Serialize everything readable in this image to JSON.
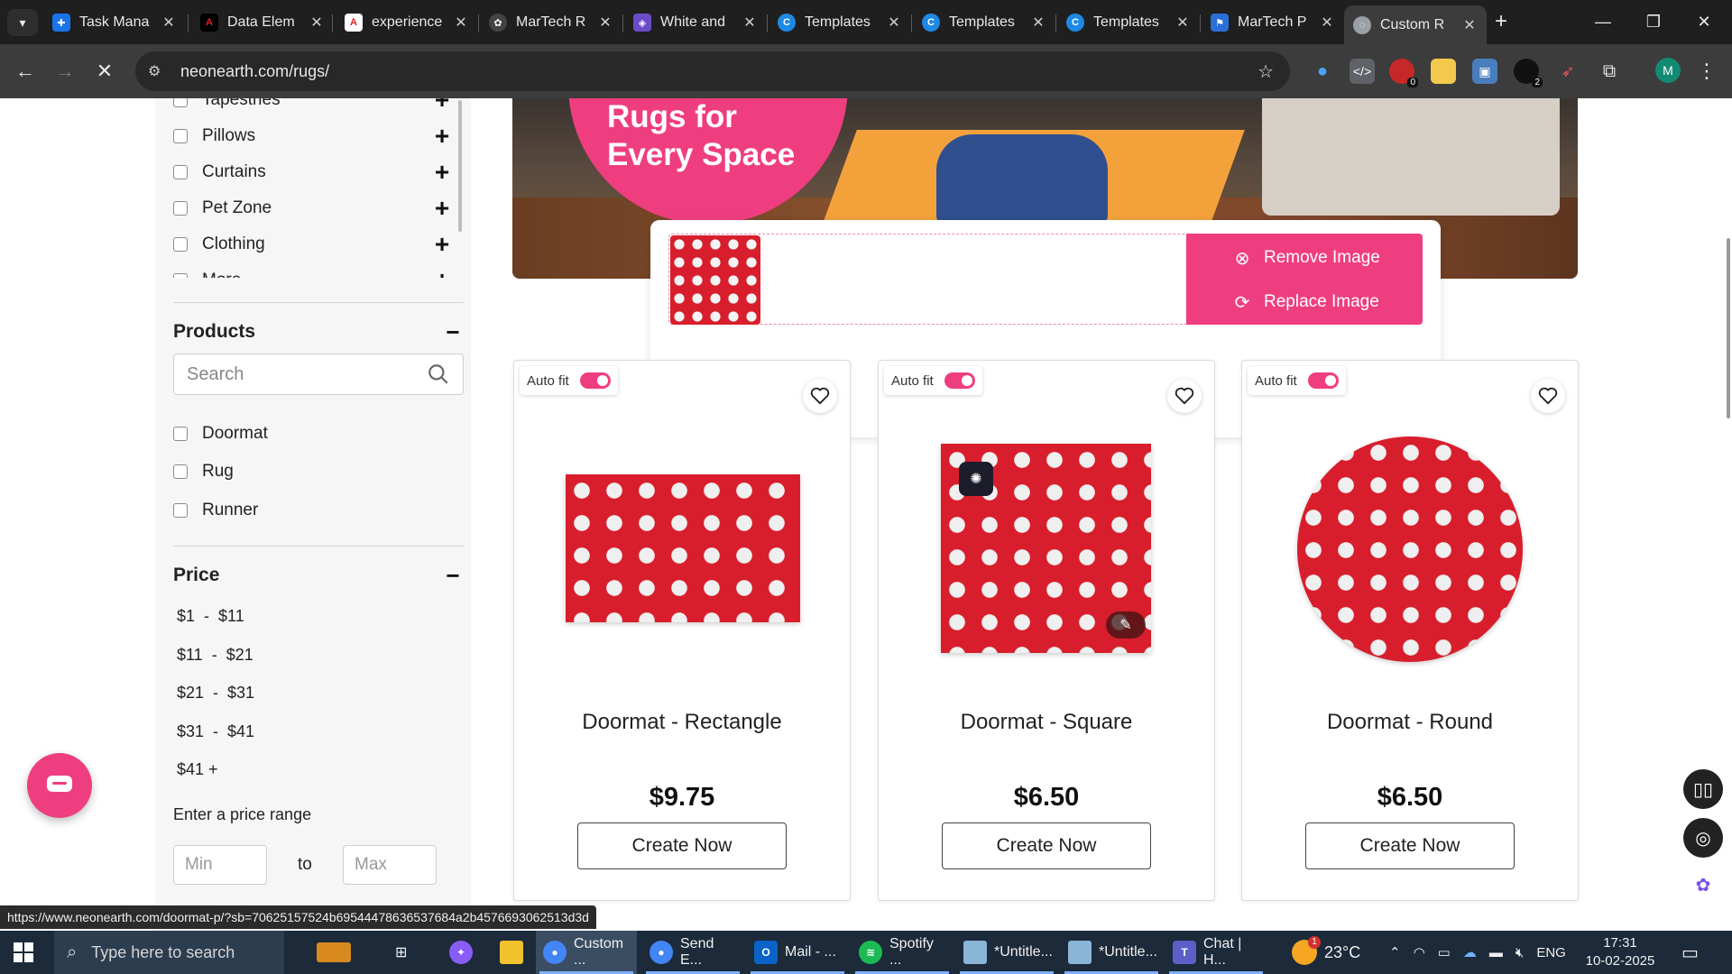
{
  "browser": {
    "tabs": [
      {
        "title": "Task Mana",
        "favicon_color": "#1a73e8"
      },
      {
        "title": "Data Elem",
        "favicon_color": "#c4161c"
      },
      {
        "title": "experience",
        "favicon_color": "#e02020"
      },
      {
        "title": "MarTech R",
        "favicon_color": "#444444"
      },
      {
        "title": "White and",
        "favicon_color": "#6a4cc7"
      },
      {
        "title": "Templates",
        "favicon_color": "#1e88e5"
      },
      {
        "title": "Templates",
        "favicon_color": "#1e88e5"
      },
      {
        "title": "Templates",
        "favicon_color": "#1e88e5"
      },
      {
        "title": "MarTech P",
        "favicon_color": "#2a6fd6"
      },
      {
        "title": "Custom R",
        "favicon_color": "#9aa0a6"
      }
    ],
    "url": "neonearth.com/rugs/",
    "profile_initial": "M",
    "extension_badges": [
      "0",
      "2"
    ]
  },
  "sidebar": {
    "categories": [
      "Tapestries",
      "Pillows",
      "Curtains",
      "Pet Zone",
      "Clothing",
      "More"
    ],
    "products_heading": "Products",
    "search_placeholder": "Search",
    "product_types": [
      "Doormat",
      "Rug",
      "Runner"
    ],
    "price_heading": "Price",
    "price_ranges": [
      "$1  -  $11",
      "$11  -  $21",
      "$21  -  $31",
      "$31  -  $41",
      "$41 +"
    ],
    "price_range_label": "Enter a price range",
    "min_placeholder": "Min",
    "to_label": "to",
    "max_placeholder": "Max"
  },
  "hero": {
    "headline": "Rugs for Every Space"
  },
  "upload": {
    "remove_label": "Remove Image",
    "replace_label": "Replace Image"
  },
  "products": [
    {
      "name": "Doormat - Rectangle",
      "price": "$9.75",
      "autofit_label": "Auto fit",
      "autofit_on": true,
      "cta": "Create Now"
    },
    {
      "name": "Doormat - Square",
      "price": "$6.50",
      "autofit_label": "Auto fit",
      "autofit_on": true,
      "cta": "Create Now"
    },
    {
      "name": "Doormat - Round",
      "price": "$6.50",
      "autofit_label": "Auto fit",
      "autofit_on": true,
      "cta": "Create Now"
    }
  ],
  "status_url": "https://www.neonearth.com/doormat-p/?sb=70625157524b6954447863653 7684a2b4576693062513d3d",
  "taskbar": {
    "search_placeholder": "Type here to search",
    "items": [
      {
        "label": "Custom ...",
        "icon": "chrome-icon",
        "color": "#4285f4"
      },
      {
        "label": "Send E...",
        "icon": "chrome-icon",
        "color": "#4285f4"
      },
      {
        "label": "Mail - ...",
        "icon": "outlook-icon",
        "color": "#0a64c8"
      },
      {
        "label": "Spotify ...",
        "icon": "spotify-icon",
        "color": "#1db954"
      },
      {
        "label": "*Untitle...",
        "icon": "notepad-icon",
        "color": "#8ab4d8"
      },
      {
        "label": "*Untitle...",
        "icon": "notepad-icon",
        "color": "#8ab4d8"
      },
      {
        "label": "Chat | H...",
        "icon": "teams-icon",
        "color": "#5b5fc7"
      }
    ],
    "weather": "23°C",
    "weather_badge": "1",
    "language": "ENG",
    "time": "17:31",
    "date": "10-02-2025"
  },
  "colors": {
    "accent_pink": "#ef3e7f",
    "rug_red": "#d81e2c"
  }
}
